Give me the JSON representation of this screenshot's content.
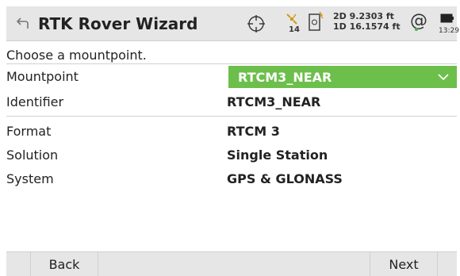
{
  "header": {
    "title": "RTK Rover Wizard",
    "satellite_count": "14",
    "precision": {
      "line1": "2D 9.2303 ft",
      "line2": "1D 16.1574 ft"
    },
    "time": "13:29",
    "icons": [
      "back-icon",
      "crosshair-icon",
      "satellite-icon",
      "phone-icon",
      "at-icon",
      "battery-icon"
    ]
  },
  "instruction": "Choose a mountpoint.",
  "fields": {
    "mountpoint": {
      "label": "Mountpoint",
      "value": "RTCM3_NEAR"
    },
    "identifier": {
      "label": "Identifier",
      "value": "RTCM3_NEAR"
    },
    "format": {
      "label": "Format",
      "value": "RTCM 3"
    },
    "solution": {
      "label": "Solution",
      "value": "Single Station"
    },
    "system": {
      "label": "System",
      "value": "GPS & GLONASS"
    }
  },
  "footer": {
    "back_label": "Back",
    "next_label": "Next"
  },
  "colors": {
    "accent_green": "#6cbf4b",
    "header_bg": "#e6e6e6"
  }
}
